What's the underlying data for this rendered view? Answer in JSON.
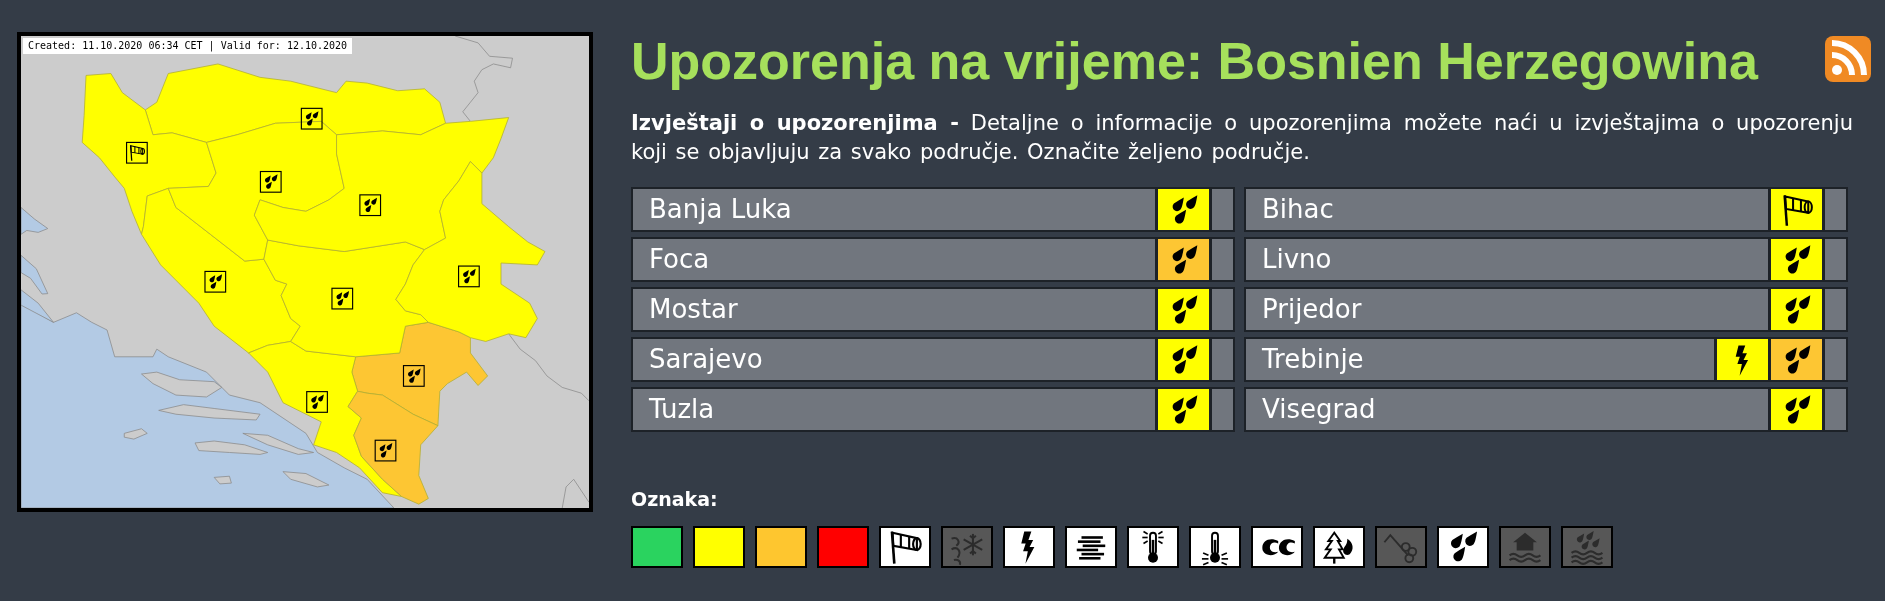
{
  "map": {
    "caption": "Created: 11.10.2020 06:34 CET | Valid for: 12.10.2020"
  },
  "title": "Upozorenja na vrijeme: Bosnien Herzegowina",
  "intro": "**Izvještaji o upozorenjima -** Detaljne o informacije o upozorenjima možete naći u izvještajima o upozorenju koji se objavljuju za svako područje. Označite željeno područje.",
  "regions": [
    {
      "name": "Banja Luka",
      "warnings": [
        {
          "kind": "rain",
          "color": "#ffff00"
        }
      ]
    },
    {
      "name": "Bihac",
      "warnings": [
        {
          "kind": "wind",
          "color": "#ffff00"
        }
      ]
    },
    {
      "name": "Foca",
      "warnings": [
        {
          "kind": "rain",
          "color": "#fdc633"
        }
      ]
    },
    {
      "name": "Livno",
      "warnings": [
        {
          "kind": "rain",
          "color": "#ffff00"
        }
      ]
    },
    {
      "name": "Mostar",
      "warnings": [
        {
          "kind": "rain",
          "color": "#ffff00"
        }
      ]
    },
    {
      "name": "Prijedor",
      "warnings": [
        {
          "kind": "rain",
          "color": "#ffff00"
        }
      ]
    },
    {
      "name": "Sarajevo",
      "warnings": [
        {
          "kind": "rain",
          "color": "#ffff00"
        }
      ]
    },
    {
      "name": "Trebinje",
      "warnings": [
        {
          "kind": "thunderstorm",
          "color": "#ffff00"
        },
        {
          "kind": "rain",
          "color": "#fdc633"
        }
      ]
    },
    {
      "name": "Tuzla",
      "warnings": [
        {
          "kind": "rain",
          "color": "#ffff00"
        }
      ]
    },
    {
      "name": "Visegrad",
      "warnings": [
        {
          "kind": "rain",
          "color": "#ffff00"
        }
      ]
    }
  ],
  "legend": {
    "title": "Oznaka:",
    "items": [
      {
        "kind": "color",
        "color": "#2ad35f",
        "disabled": false
      },
      {
        "kind": "color",
        "color": "#ffff00",
        "disabled": false
      },
      {
        "kind": "color",
        "color": "#fec62f",
        "disabled": false
      },
      {
        "kind": "color",
        "color": "#ff0000",
        "disabled": false
      },
      {
        "kind": "wind",
        "disabled": false
      },
      {
        "kind": "snow-ice",
        "disabled": true
      },
      {
        "kind": "thunderstorm",
        "disabled": false
      },
      {
        "kind": "fog",
        "disabled": false
      },
      {
        "kind": "high-temperature",
        "disabled": false
      },
      {
        "kind": "low-temperature",
        "disabled": false
      },
      {
        "kind": "coastal",
        "disabled": false
      },
      {
        "kind": "forest-fire",
        "disabled": false
      },
      {
        "kind": "avalanche",
        "disabled": true
      },
      {
        "kind": "rain",
        "disabled": false
      },
      {
        "kind": "flood",
        "disabled": true
      },
      {
        "kind": "rain-flood",
        "disabled": true
      }
    ]
  }
}
